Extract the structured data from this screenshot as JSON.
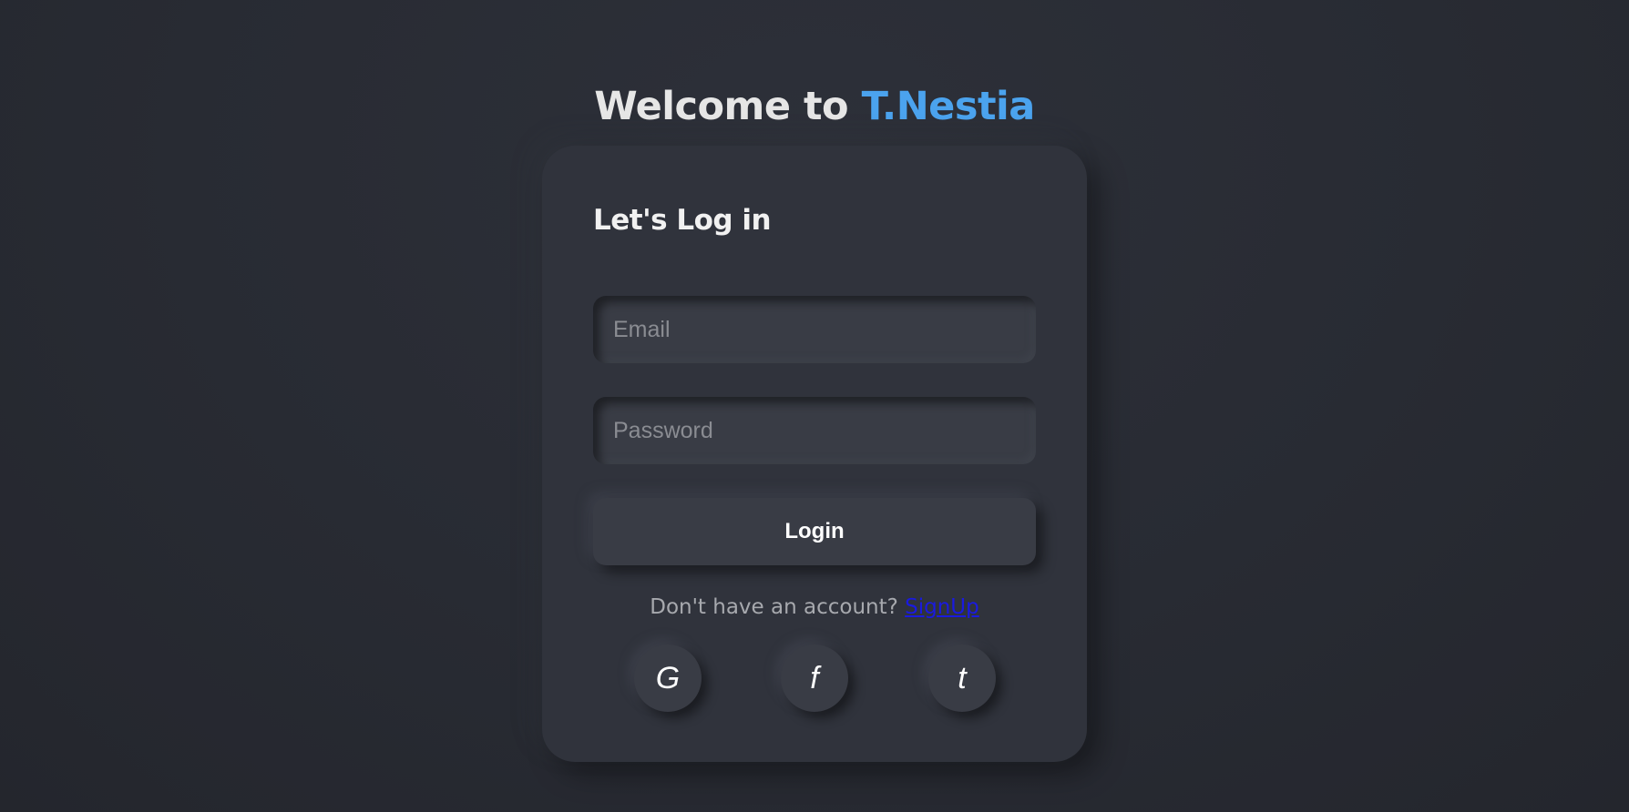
{
  "header": {
    "welcome_prefix": "Welcome to ",
    "brand_name": "T.Nestia"
  },
  "login_card": {
    "title": "Let's Log in",
    "email_placeholder": "Email",
    "password_placeholder": "Password",
    "login_label": "Login",
    "signup_prompt": "Don't have an account? ",
    "signup_link": "SignUp"
  },
  "social": [
    {
      "icon": "google-icon",
      "glyph": "G"
    },
    {
      "icon": "facebook-icon",
      "glyph": "f"
    },
    {
      "icon": "twitter-icon",
      "glyph": "t"
    }
  ],
  "colors": {
    "background": "#282b33",
    "card": "#30333c",
    "brand_accent": "#4ba3ee",
    "link": "#1a1adf"
  }
}
